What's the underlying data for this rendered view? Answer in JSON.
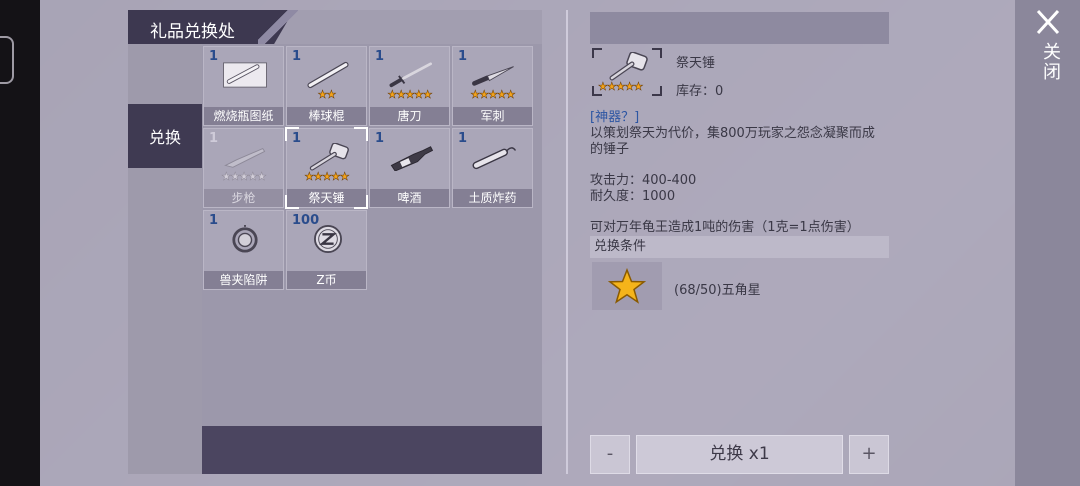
{
  "panel": {
    "title": "礼品兑换处",
    "side_tab": "兑换"
  },
  "items": [
    {
      "name": "燃烧瓶图纸",
      "count": "1",
      "stars": "",
      "dim": false,
      "icon": "blueprint-icon"
    },
    {
      "name": "棒球棍",
      "count": "1",
      "stars": "★★",
      "dim": false,
      "icon": "baseball-bat-icon"
    },
    {
      "name": "唐刀",
      "count": "1",
      "stars": "★★★★★",
      "dim": false,
      "icon": "katana-icon"
    },
    {
      "name": "军刺",
      "count": "1",
      "stars": "★★★★★",
      "dim": false,
      "icon": "bayonet-icon"
    },
    {
      "name": "步枪",
      "count": "1",
      "stars": "★★★★★",
      "dim": true,
      "icon": "rifle-icon"
    },
    {
      "name": "祭天锤",
      "count": "1",
      "stars": "★★★★★",
      "dim": false,
      "icon": "hammer-icon",
      "selected": true
    },
    {
      "name": "啤酒",
      "count": "1",
      "stars": "",
      "dim": false,
      "icon": "beer-bottle-icon"
    },
    {
      "name": "土质炸药",
      "count": "1",
      "stars": "",
      "dim": false,
      "icon": "dynamite-icon"
    },
    {
      "name": "兽夹陷阱",
      "count": "1",
      "stars": "",
      "dim": false,
      "icon": "bear-trap-icon"
    },
    {
      "name": "Z币",
      "count": "100",
      "stars": "",
      "dim": false,
      "icon": "z-coin-icon"
    }
  ],
  "detail": {
    "name": "祭天锤",
    "stars": "★★★★★",
    "stock": "库存：0",
    "tag": "[神器？]",
    "desc_line1": "以策划祭天为代价，集800万玩家之怨念凝聚而成",
    "desc_line2": "的锤子",
    "attack": "攻击力：400-400",
    "durability": "耐久度：1000",
    "effect": "可对万年龟王造成1吨的伤害（1克=1点伤害）",
    "condition_title": "兑换条件",
    "condition_text": "(68/50)五角星"
  },
  "controls": {
    "minus": "-",
    "plus": "+",
    "exchange": "兑换 x1",
    "close": "关闭"
  },
  "colors": {
    "accent_dark": "#3d3850",
    "star": "#f3a31b",
    "count_blue": "#2a4c8c"
  }
}
